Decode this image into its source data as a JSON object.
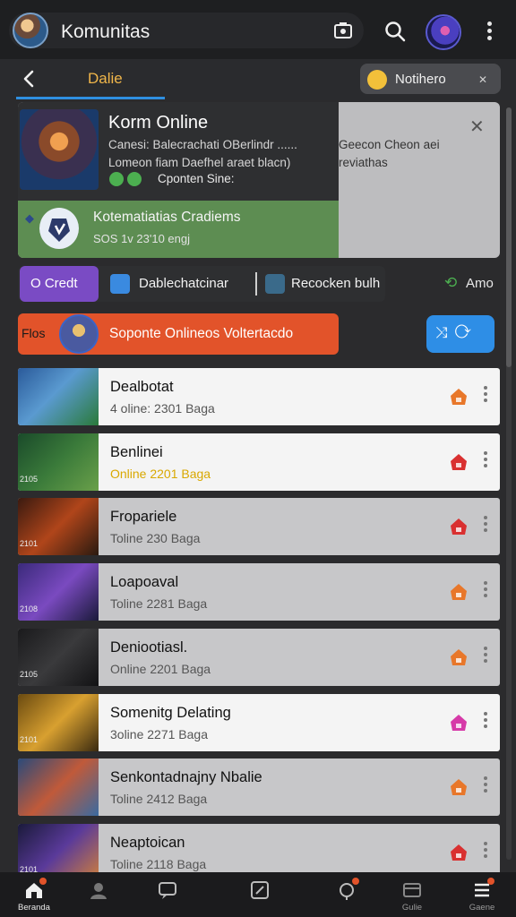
{
  "app_bar": {
    "title": "Komunitas"
  },
  "sub_bar": {
    "tab_label": "Dalie",
    "notification_label": "Notihero"
  },
  "featured": {
    "title": "Korm Online",
    "description": "Canesi: Balecrachati OBerlindr ...... Lomeon fiam Daefhel araet blacn)",
    "side_text": "Geecon Cheon aei reviathas",
    "chip_label": "Cponten Sine:",
    "group_title": "Kotematiatias Cradiems",
    "group_meta": "SOS 1v 23'10 engj"
  },
  "actions": {
    "credit_label": "O  Credt",
    "dash_label": "Dablechatcinar",
    "reco_label": "Recocken bulh",
    "amo_label": "Amo"
  },
  "promo": {
    "tag": "Flos",
    "label": "Soponte Onlineos Voltertacdo"
  },
  "communities": [
    {
      "title": "Dealbotat",
      "subtitle": "4 oline: 2301 Baga",
      "light": true,
      "gold": false,
      "badge_color": "#e8772a",
      "thumb": "blue",
      "tag": ""
    },
    {
      "title": "Benlinei",
      "subtitle": "Online 2201 Baga",
      "light": true,
      "gold": true,
      "badge_color": "#d93030",
      "thumb": "green",
      "tag": "2105"
    },
    {
      "title": "Fropariele",
      "subtitle": "Toline 230 Baga",
      "light": false,
      "gold": false,
      "badge_color": "#d93030",
      "thumb": "red",
      "tag": "2101"
    },
    {
      "title": "Loapoaval",
      "subtitle": "Toline 2281 Baga",
      "light": false,
      "gold": false,
      "badge_color": "#e8772a",
      "thumb": "purple",
      "tag": "2108"
    },
    {
      "title": "Deniootiasl.",
      "subtitle": "Online 2201 Baga",
      "light": false,
      "gold": false,
      "badge_color": "#e8772a",
      "thumb": "dark",
      "tag": "2105"
    },
    {
      "title": "Somenitg Delating",
      "subtitle": "3oline 2271 Baga",
      "light": true,
      "gold": false,
      "badge_color": "#d63aa8",
      "thumb": "gold",
      "tag": "2101"
    },
    {
      "title": "Senkontadnajny Nbalie",
      "subtitle": "Toline 2412 Baga",
      "light": false,
      "gold": false,
      "badge_color": "#e8772a",
      "thumb": "sky",
      "tag": ""
    },
    {
      "title": "Neaptoican",
      "subtitle": "Toline 2118 Baga",
      "light": false,
      "gold": false,
      "badge_color": "#d93030",
      "thumb": "violet",
      "tag": "2101"
    }
  ],
  "bottom_nav": [
    {
      "label": "Beranda",
      "icon": "home-icon",
      "active": true,
      "dot": true
    },
    {
      "label": "",
      "icon": "people-icon",
      "active": false,
      "dot": false
    },
    {
      "label": "",
      "icon": "chat-icon",
      "active": false,
      "dot": false
    },
    {
      "label": "",
      "icon": "compose-icon",
      "active": false,
      "dot": false
    },
    {
      "label": "",
      "icon": "notification-icon",
      "active": false,
      "dot": true
    },
    {
      "label": "Gulie",
      "icon": "library-icon",
      "active": false,
      "dot": false
    },
    {
      "label": "Gaene",
      "icon": "menu-icon",
      "active": false,
      "dot": true
    }
  ]
}
